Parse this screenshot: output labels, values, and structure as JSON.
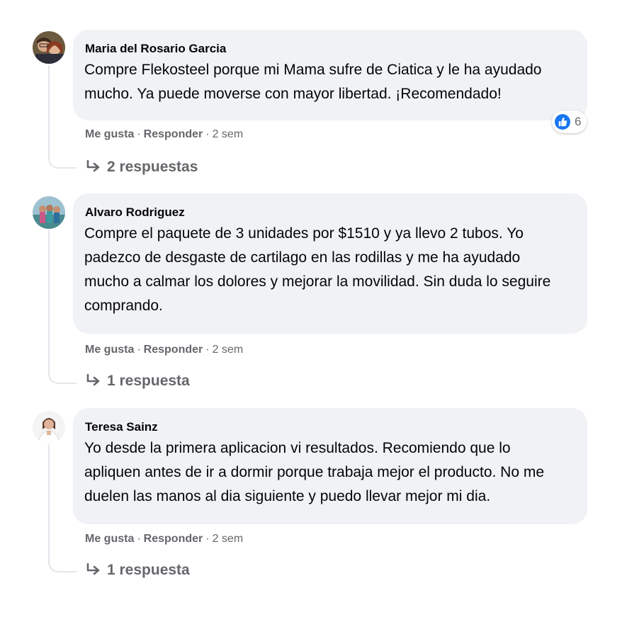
{
  "comments": [
    {
      "author": "Maria del Rosario Garcia",
      "lines": [
        "Compre Flekosteel porque mi Mama sufre de Ciatica y le ha ayudado",
        "mucho. Ya puede moverse con mayor libertad. ¡Recomendado!"
      ],
      "like_label": "Me gusta",
      "reply_label": "Responder",
      "time": "2 sem",
      "replies_label": "2 respuestas",
      "reaction_count": "6"
    },
    {
      "author": "Alvaro Rodriguez",
      "lines": [
        "Compre el paquete de 3 unidades por $1510 y ya llevo 2 tubos. Yo",
        "padezco de desgaste de cartilago en las rodillas y me ha ayudado",
        "mucho a calmar los dolores y mejorar la movilidad. Sin duda lo seguire",
        "comprando."
      ],
      "like_label": "Me gusta",
      "reply_label": "Responder",
      "time": "2 sem",
      "replies_label": "1 respuesta"
    },
    {
      "author": "Teresa Sainz",
      "lines": [
        "Yo desde la primera aplicacion vi resultados. Recomiendo que lo",
        "apliquen antes de ir a dormir porque trabaja mejor el producto. No me",
        "duelen las manos al dia siguiente y puedo llevar mejor mi dia."
      ],
      "like_label": "Me gusta",
      "reply_label": "Responder",
      "time": "2 sem",
      "replies_label": "1 respuesta"
    }
  ],
  "separator": "·",
  "icons": {
    "like_reaction": "thumbs-up-icon",
    "reply_arrow": "reply-arrow-icon"
  },
  "colors": {
    "bubble": "#f0f2f5",
    "secondary_text": "#65676b",
    "like_blue": "#1877f2"
  }
}
